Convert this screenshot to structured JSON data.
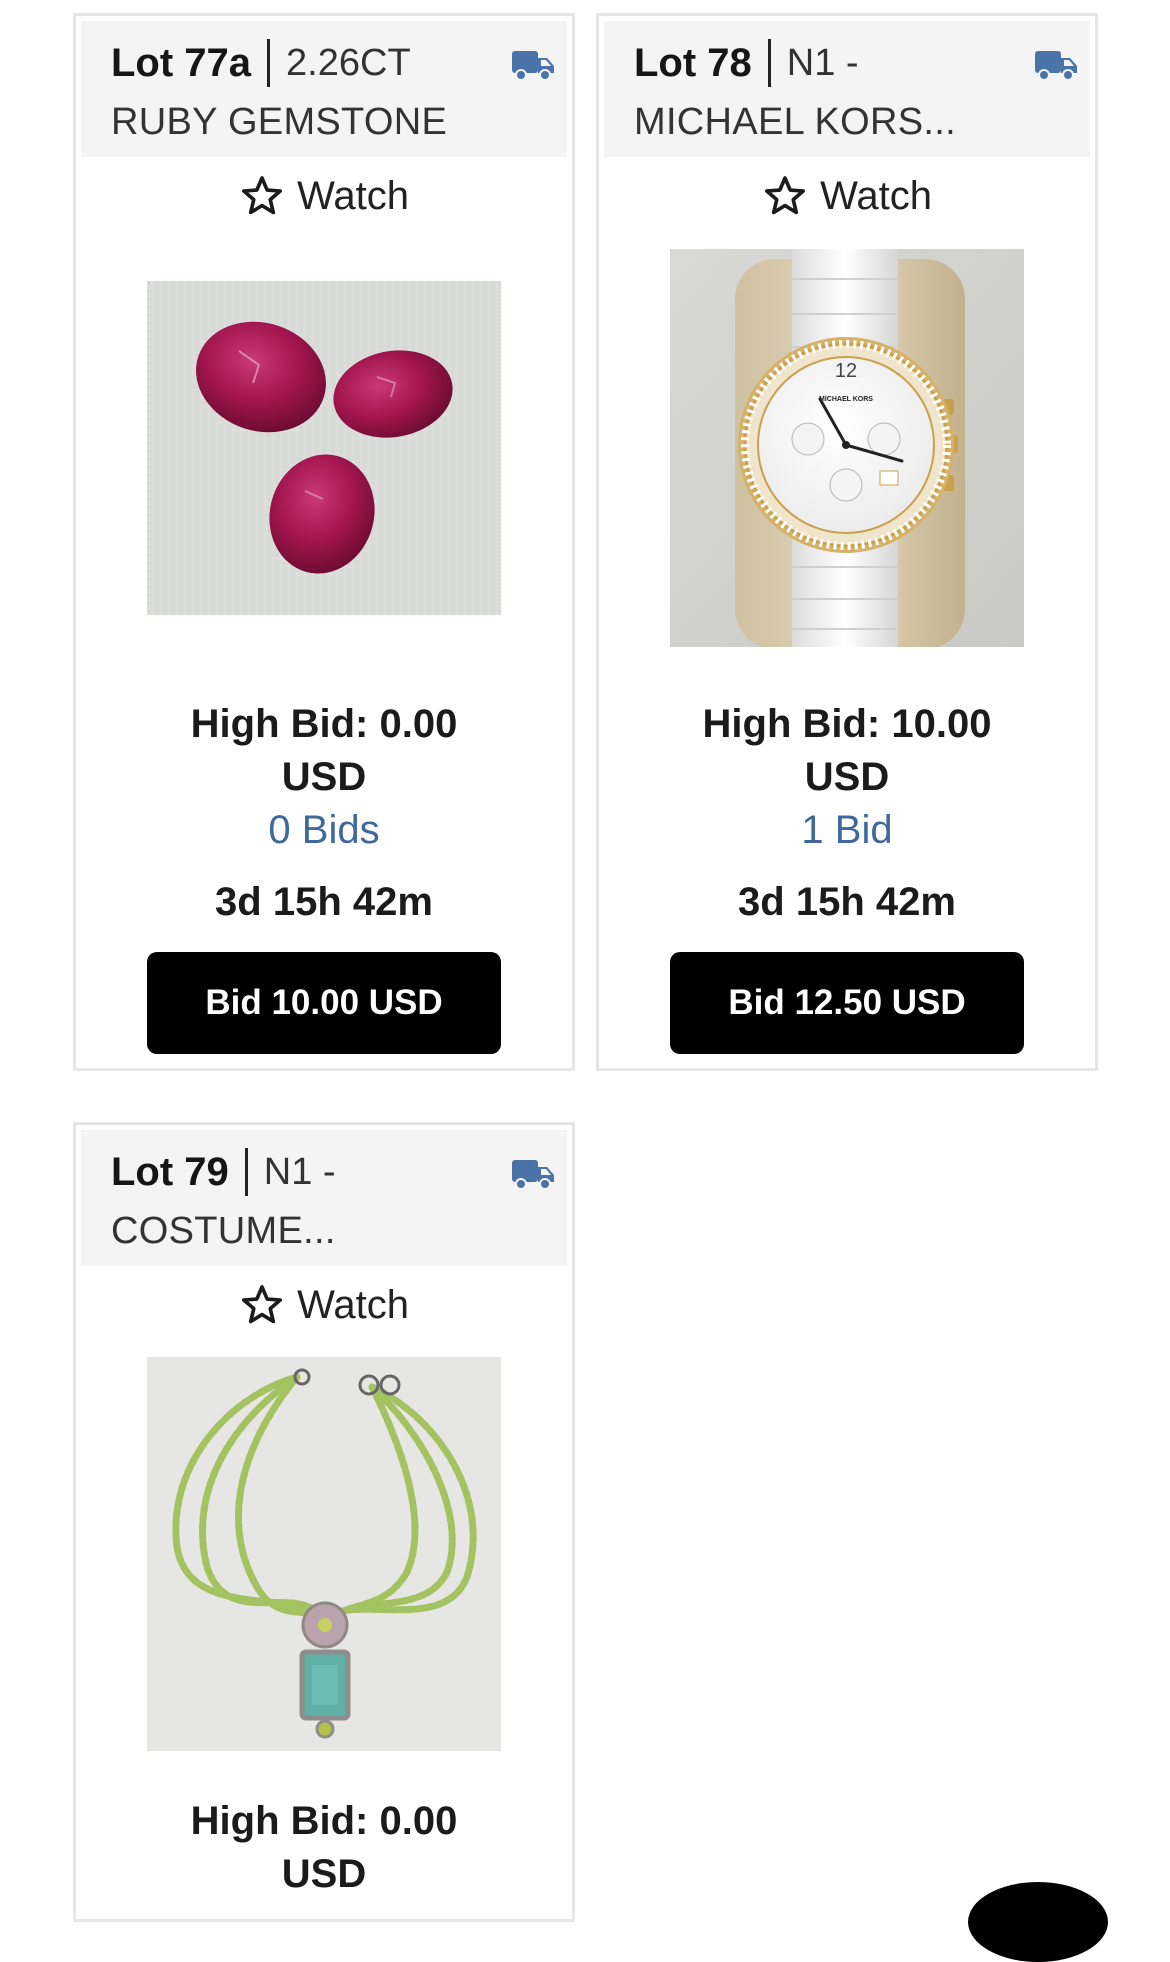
{
  "colors": {
    "accent_blue": "#3f689c",
    "truck_icon": "#4a74a8",
    "button_bg": "#000000",
    "header_bg": "#f4f4f4",
    "card_border": "#e6e6e6"
  },
  "lots": [
    {
      "lot_label": "Lot 77a",
      "title_first": "2.26CT",
      "title_second": "RUBY GEMSTONE",
      "shipping_icon": "truck-icon",
      "watch_label": "Watch",
      "high_bid": "High Bid: 0.00",
      "high_bid_currency": "USD",
      "bid_count": "0 Bids",
      "time_left": "3d 15h 42m",
      "bid_button": "Bid 10.00 USD",
      "image": "ruby-gemstones-photo"
    },
    {
      "lot_label": "Lot 78",
      "title_first": "N1 -",
      "title_second": "MICHAEL KORS...",
      "shipping_icon": "truck-icon",
      "watch_label": "Watch",
      "high_bid": "High Bid: 10.00",
      "high_bid_currency": "USD",
      "bid_count": "1 Bid",
      "time_left": "3d 15h 42m",
      "bid_button": "Bid 12.50 USD",
      "image": "watch-photo",
      "watch_dial_brand": "MICHAEL KORS"
    },
    {
      "lot_label": "Lot 79",
      "title_first": "N1 -",
      "title_second": "COSTUME...",
      "shipping_icon": "truck-icon",
      "watch_label": "Watch",
      "high_bid": "High Bid: 0.00",
      "high_bid_currency": "USD",
      "image": "necklace-photo"
    }
  ]
}
